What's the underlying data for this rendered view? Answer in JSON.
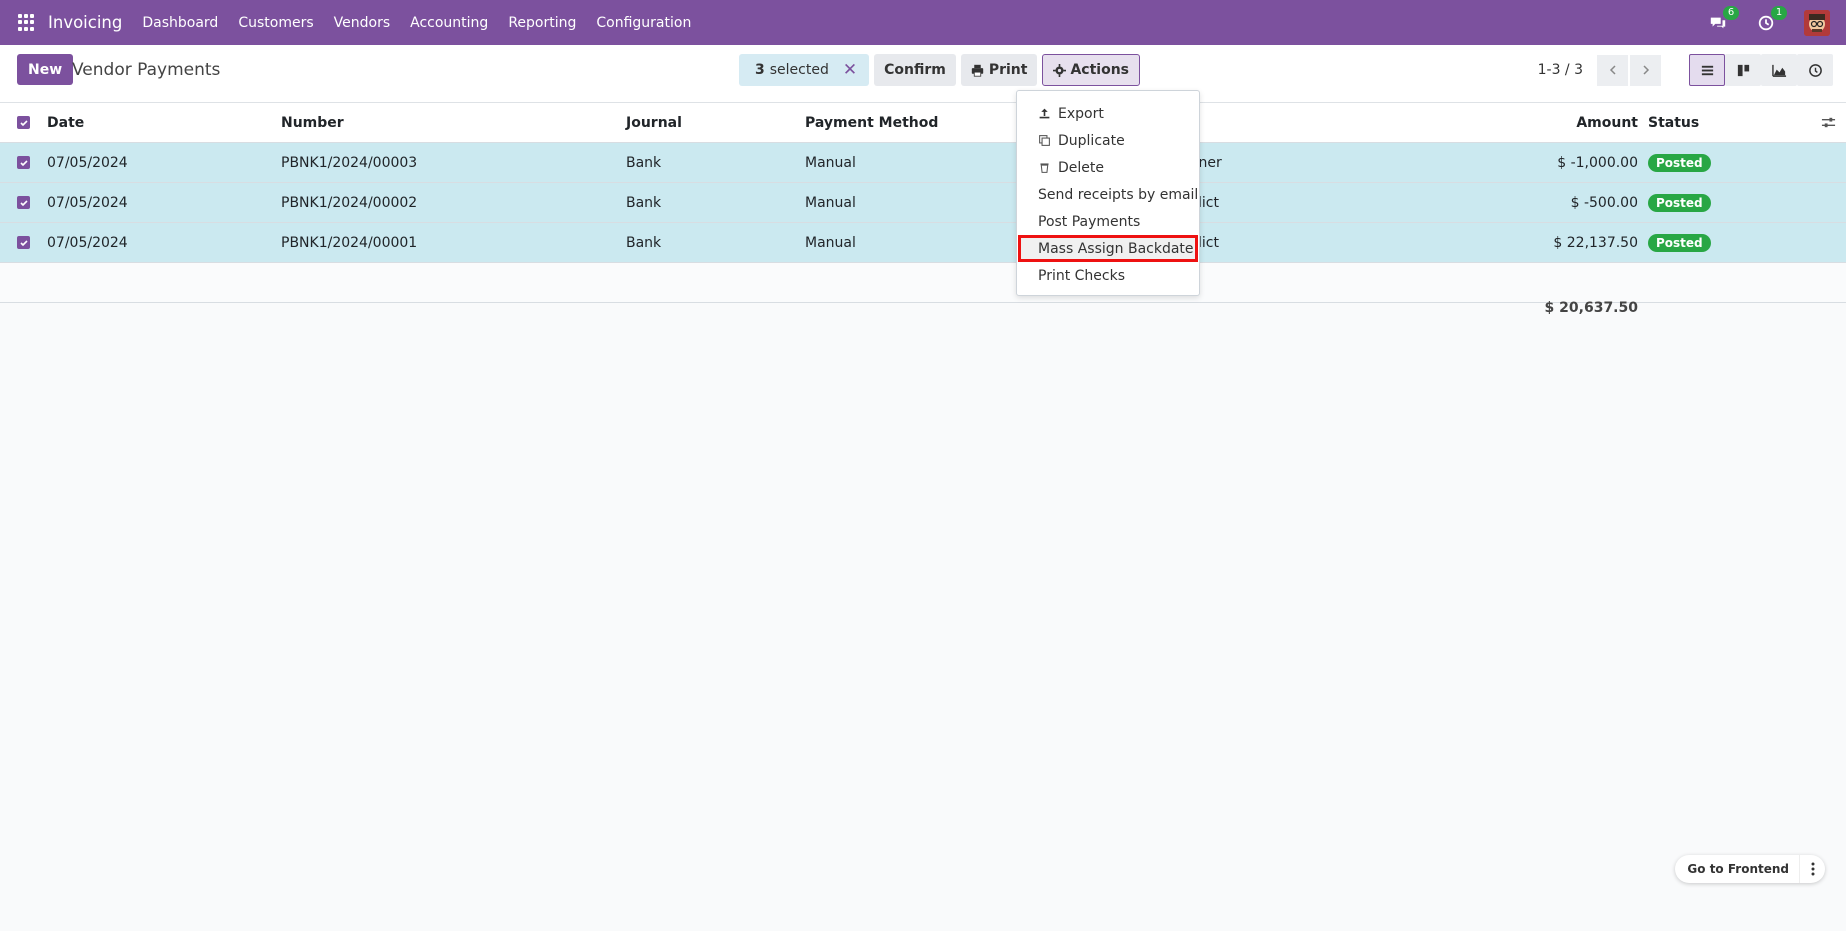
{
  "nav": {
    "app_name": "Invoicing",
    "items": [
      "Dashboard",
      "Customers",
      "Vendors",
      "Accounting",
      "Reporting",
      "Configuration"
    ],
    "messages_badge": "6",
    "activity_badge": "1"
  },
  "control": {
    "new_label": "New",
    "title": "Vendor Payments",
    "selected_count": "3",
    "selected_label": "selected",
    "confirm_label": "Confirm",
    "print_label": "Print",
    "actions_label": "Actions",
    "pager_value": "1-3 / 3"
  },
  "table": {
    "headers": {
      "date": "Date",
      "number": "Number",
      "journal": "Journal",
      "method": "Payment Method",
      "amount": "Amount",
      "status": "Status"
    },
    "rows": [
      {
        "date": "07/05/2024",
        "number": "PBNK1/2024/00003",
        "journal": "Bank",
        "method": "Manual",
        "partner": "rner",
        "amount": "$ -1,000.00",
        "status": "Posted"
      },
      {
        "date": "07/05/2024",
        "number": "PBNK1/2024/00002",
        "journal": "Bank",
        "method": "Manual",
        "partner": "dict",
        "amount": "$ -500.00",
        "status": "Posted"
      },
      {
        "date": "07/05/2024",
        "number": "PBNK1/2024/00001",
        "journal": "Bank",
        "method": "Manual",
        "partner": "dict",
        "amount": "$ 22,137.50",
        "status": "Posted"
      }
    ],
    "total": "$ 20,637.50"
  },
  "actions_menu": {
    "items": [
      "Export",
      "Duplicate",
      "Delete",
      "Send receipts by email",
      "Post Payments",
      "Mass Assign Backdate",
      "Print Checks"
    ]
  },
  "footer": {
    "frontend_label": "Go to Frontend"
  },
  "colors": {
    "brand": "#7c519e",
    "selected_row": "#cbe9f0",
    "posted": "#28a745",
    "highlight_border": "#e11111"
  }
}
